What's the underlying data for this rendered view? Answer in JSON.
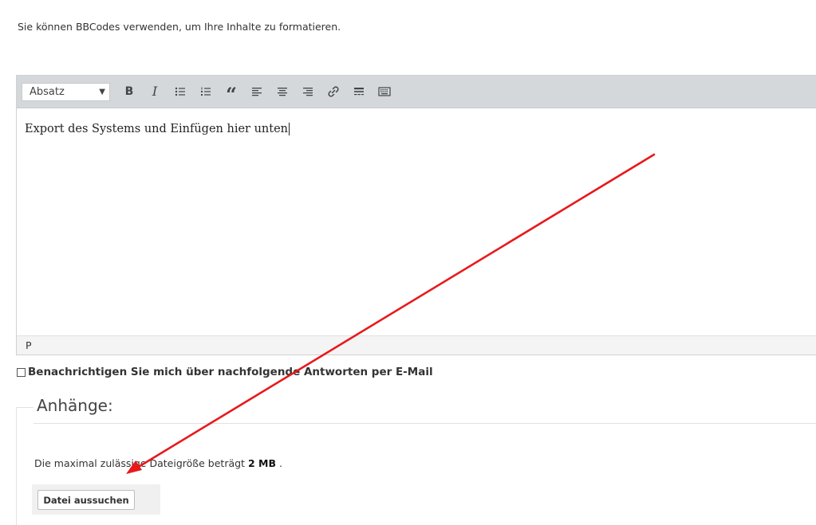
{
  "hint": {
    "bbcode_text": "Sie können BBCodes verwenden, um Ihre Inhalte zu formatieren."
  },
  "editor": {
    "format_select": {
      "value": "Absatz"
    },
    "toolbar": [
      {
        "name": "bold-button",
        "icon": "bold-icon",
        "glyph": "B"
      },
      {
        "name": "italic-button",
        "icon": "italic-icon",
        "glyph": "I"
      },
      {
        "name": "bullet-list-button",
        "icon": "bullet-list-icon"
      },
      {
        "name": "numbered-list-button",
        "icon": "numbered-list-icon"
      },
      {
        "name": "blockquote-button",
        "icon": "quote-icon",
        "glyph": "“"
      },
      {
        "name": "align-left-button",
        "icon": "align-left-icon"
      },
      {
        "name": "align-center-button",
        "icon": "align-center-icon"
      },
      {
        "name": "align-right-button",
        "icon": "align-right-icon"
      },
      {
        "name": "link-button",
        "icon": "link-icon"
      },
      {
        "name": "horizontal-rule-button",
        "icon": "horizontal-rule-icon"
      },
      {
        "name": "keyboard-button",
        "icon": "keyboard-icon"
      }
    ],
    "content_text": "Export des Systems und Einfügen hier unten",
    "status_path": "P"
  },
  "notify": {
    "label": "Benachrichtigen Sie mich über nachfolgende Antworten per E-Mail",
    "checked": false
  },
  "attachments": {
    "legend": "Anhänge:",
    "max_size_prefix": "Die maximal zulässige Dateigröße beträgt",
    "max_size_value": "2 MB",
    "max_size_suffix": ".",
    "choose_file_label": "Datei aussuchen"
  },
  "colors": {
    "toolbar_bg": "#d5d8db",
    "annotation_arrow": "#e8191b"
  }
}
